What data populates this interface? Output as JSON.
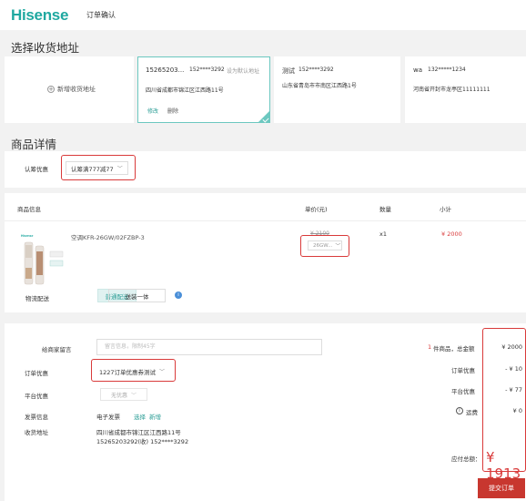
{
  "header": {
    "logo": "Hisense",
    "title": "订单确认"
  },
  "address_section": {
    "title": "选择收货地址",
    "add_label": "新增收货地址",
    "cards": [
      {
        "name": "15265203...",
        "phone": "152****3292",
        "default_label": "设为默认地址",
        "address": "四川省成都市锦江区江西路11号",
        "edit": "修改",
        "delete": "删除",
        "selected": true
      },
      {
        "name": "测试",
        "phone": "152****3292",
        "address": "山东省青岛市市南区江西路1号",
        "selected": false
      },
      {
        "name": "wa",
        "phone": "132*****1234",
        "address": "河南省开封市龙亭区11111111",
        "selected": false
      }
    ]
  },
  "goods_section": {
    "title": "商品详情",
    "promo_label": "认筹优惠",
    "promo_value": "认筹满777减77",
    "columns": {
      "info": "商品信息",
      "price": "单价(元)",
      "qty": "数量",
      "subtotal": "小计"
    },
    "product": {
      "name": "空调KFR-26GW/02FZBP-3",
      "old_price": "¥ 2100",
      "spec": "26GW...",
      "qty": "x1",
      "subtotal": "¥ 2000",
      "image_brand": "Hisense"
    },
    "shipping_label": "物流配送",
    "shipping_options": [
      "普通配送",
      "送装一体"
    ],
    "info_icon": "i"
  },
  "order_section": {
    "message_label": "给商家留言",
    "message_placeholder": "留言信息，限制45字",
    "coupon_label": "订单优惠",
    "coupon_value": "1227订单优惠券测试",
    "platform_label": "平台优惠",
    "platform_value": "无优惠",
    "invoice_label": "发票信息",
    "invoice_value": "电子发票",
    "invoice_choose": "选择",
    "invoice_add": "新增",
    "ship_addr_label": "收货地址",
    "ship_addr_line1": "四川省成都市锦江区江西路11号",
    "ship_addr_line2": "15265203292(收) 152****3292"
  },
  "summary": {
    "count_prefix": "1",
    "count_label": "件商品，总金额",
    "total": "¥ 2000",
    "order_discount_label": "订单优惠",
    "order_discount": "- ¥ 10",
    "platform_discount_label": "平台优惠",
    "platform_discount": "- ¥ 77",
    "freight_label": "运费",
    "freight": "¥ 0",
    "pay_label": "应付总额：",
    "pay_total": "¥ 1913",
    "submit": "提交订单"
  },
  "colors": {
    "brand": "#1fa8a0",
    "accent_red": "#d93a3a",
    "submit_bg": "#c8372f",
    "selected_border": "#6cc8c0"
  }
}
